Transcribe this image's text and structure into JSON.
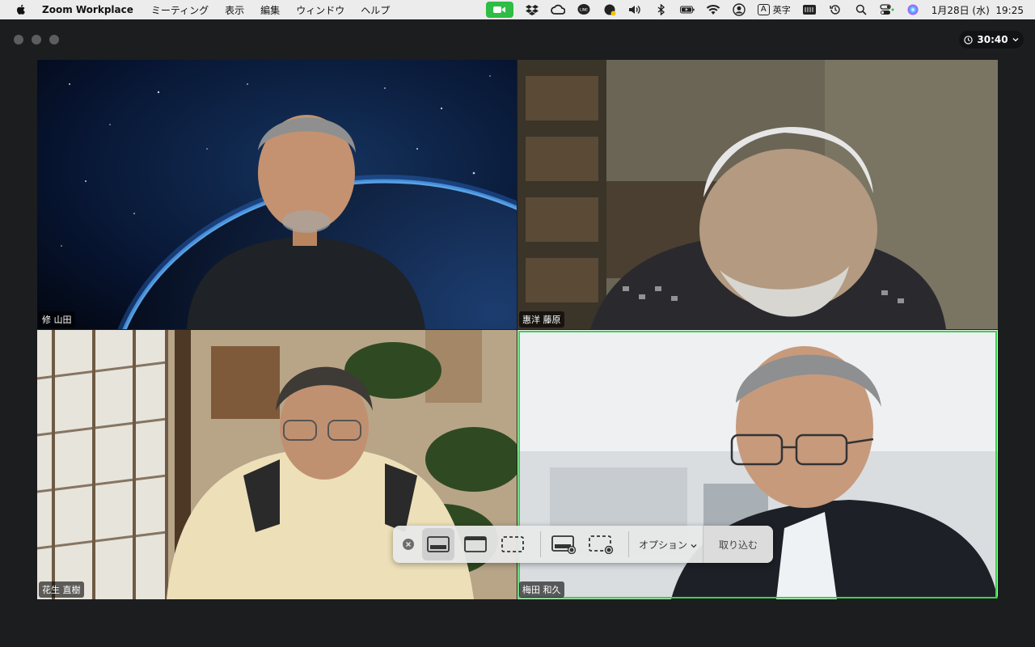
{
  "menubar": {
    "app_name": "Zoom Workplace",
    "menus": [
      "ミーティング",
      "表示",
      "編集",
      "ウィンドウ",
      "ヘルプ"
    ],
    "input_mode_key": "A",
    "input_mode_label": "英字",
    "datetime": "1月28日 (水)  19:25",
    "tray_icons": [
      "zoom-video-icon",
      "dropbox-icon",
      "creative-cloud-icon",
      "line-icon",
      "ai-assistant-icon",
      "volume-icon",
      "bluetooth-icon",
      "battery-icon",
      "wifi-icon",
      "user-icon",
      "input-mode-icon",
      "keyboard-icon",
      "time-machine-icon",
      "search-icon",
      "control-center-icon",
      "siri-icon"
    ]
  },
  "meeting": {
    "timer": "30:40",
    "participants": [
      {
        "name": "修 山田",
        "background": "space-earth"
      },
      {
        "name": "惠洋 藤原",
        "background": "library-room"
      },
      {
        "name": "花生 直樹",
        "background": "japanese-room"
      },
      {
        "name": "梅田 和久",
        "background": "office-blur",
        "active_speaker": true
      }
    ]
  },
  "screenshot_toolbar": {
    "options_label": "オプション",
    "capture_label": "取り込む",
    "modes": [
      "capture-entire-screen",
      "capture-window",
      "capture-selection",
      "record-entire-screen",
      "record-selection"
    ],
    "selected_mode": "capture-entire-screen"
  },
  "colors": {
    "menubar_bg": "#ececec",
    "window_bg": "#1b1d1f",
    "speaker_border": "#3ed04f",
    "zoom_green": "#2ebd45"
  }
}
